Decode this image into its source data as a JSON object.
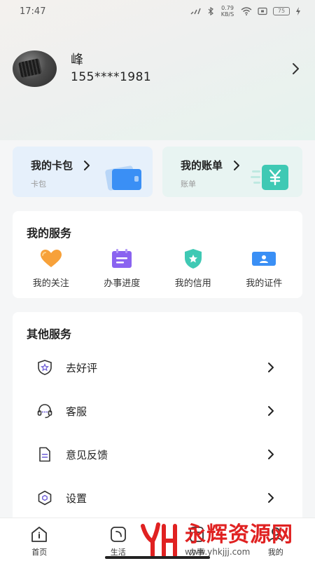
{
  "status_bar": {
    "time": "17:47",
    "network_speed": "0.79 KB/S",
    "battery": "75"
  },
  "profile": {
    "name": "峰",
    "phone": "155****1981"
  },
  "cards": {
    "wallet": {
      "title": "我的卡包",
      "subtitle": "卡包"
    },
    "bill": {
      "title": "我的账单",
      "subtitle": "账单"
    }
  },
  "my_services": {
    "title": "我的服务",
    "items": [
      {
        "label": "我的关注",
        "icon": "heart-icon"
      },
      {
        "label": "办事进度",
        "icon": "calendar-icon"
      },
      {
        "label": "我的信用",
        "icon": "shield-star-icon"
      },
      {
        "label": "我的证件",
        "icon": "id-card-icon"
      }
    ]
  },
  "other_services": {
    "title": "其他服务",
    "items": [
      {
        "label": "去好评",
        "icon": "shield-star-outline-icon"
      },
      {
        "label": "客服",
        "icon": "headset-icon"
      },
      {
        "label": "意见反馈",
        "icon": "document-icon"
      },
      {
        "label": "设置",
        "icon": "hexagon-settings-icon"
      }
    ]
  },
  "tab_bar": {
    "items": [
      {
        "label": "首页",
        "icon": "home-icon"
      },
      {
        "label": "生活",
        "icon": "life-icon"
      },
      {
        "label": "办事",
        "icon": "affairs-icon"
      },
      {
        "label": "我的",
        "icon": "profile-icon"
      }
    ]
  },
  "watermark": {
    "text": "永辉资源网",
    "url": "www.yhkjjj.com"
  },
  "colors": {
    "wallet_blue": "#3a8ff5",
    "bill_teal": "#3fc9b4",
    "heart_orange": "#f7a13a",
    "calendar_purple": "#8a63f0",
    "watermark_red": "#e02121"
  }
}
